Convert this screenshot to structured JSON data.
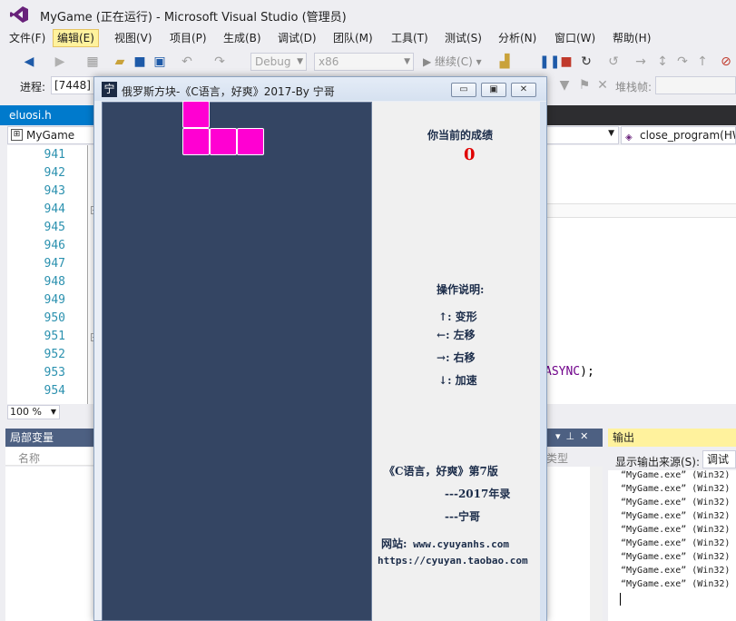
{
  "colors": {
    "vs_chrome": "#eeeef2",
    "tab_active": "#007acc",
    "panel_header": "#4d6082",
    "output_header": "#fff29d",
    "game_board": "#344563",
    "tetromino": "#ff00d2",
    "score": "#e00000"
  },
  "vs": {
    "window_title": "MyGame (正在运行) - Microsoft Visual Studio (管理员)",
    "logo_icon": "visual-studio-logo",
    "menu": [
      "文件(F)",
      "编辑(E)",
      "视图(V)",
      "项目(P)",
      "生成(B)",
      "调试(D)",
      "团队(M)",
      "工具(T)",
      "测试(S)",
      "分析(N)",
      "窗口(W)",
      "帮助(H)"
    ],
    "active_menu_index": 1,
    "toolbar": {
      "config": "Debug",
      "platform": "x86",
      "continue_label": "继续(C)"
    },
    "debug_location": {
      "process_label": "进程:",
      "process_value": "[7448] M",
      "stackframe_label": "堆栈帧:"
    },
    "document_tab": "eluosi.h",
    "nav": {
      "project": "MyGame",
      "member": "close_program(HW"
    },
    "line_numbers": [
      "941",
      "942",
      "943",
      "944",
      "945",
      "946",
      "947",
      "948",
      "949",
      "950",
      "951",
      "952",
      "953",
      "954"
    ],
    "code_fragment": "ASYNC",
    "code_fragment_tail": ");",
    "zoom": "100 %",
    "locals": {
      "title": "局部变量",
      "col_name": "名称",
      "col_type": "类型"
    },
    "output": {
      "title": "输出",
      "source_label": "显示输出来源(S):",
      "source_value": "调试",
      "lines": [
        "“MyGame.exe” (Win32)",
        "“MyGame.exe” (Win32)",
        "“MyGame.exe” (Win32)",
        "“MyGame.exe” (Win32)",
        "“MyGame.exe” (Win32)",
        "“MyGame.exe” (Win32)",
        "“MyGame.exe” (Win32)",
        "“MyGame.exe” (Win32)",
        "“MyGame.exe” (Win32)"
      ]
    }
  },
  "game": {
    "icon_glyph": "宁",
    "title": "俄罗斯方块-《C语言，好爽》2017-By 宁哥",
    "window_buttons": {
      "minimize": "▭",
      "maximize": "▣",
      "close": "✕"
    },
    "score_label": "你当前的成绩",
    "score": "0",
    "controls_title": "操作说明:",
    "controls": [
      {
        "key": "↑",
        "action": "变形"
      },
      {
        "key": "←",
        "action": "左移"
      },
      {
        "key": "→",
        "action": "右移"
      },
      {
        "key": "↓",
        "action": "加速"
      }
    ],
    "book_title": "《C语言，好爽》第7版",
    "book_year": "---2017年录",
    "book_author": "---宁哥",
    "website_label": "网站:",
    "website": "www.cyuyanhs.com",
    "shop_url": "https://cyuyan.taobao.com",
    "falling_piece": "J-tetromino"
  }
}
